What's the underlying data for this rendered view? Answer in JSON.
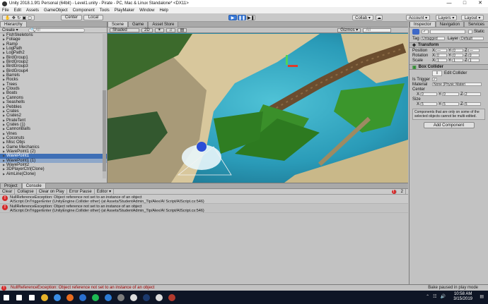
{
  "window": {
    "title": "Unity 2018.1.9f1 Personal (64bit) - Level1.unity - Pirate - PC, Mac & Linux Standalone* <DX11>",
    "controls": [
      "—",
      "□",
      "✕"
    ]
  },
  "menu": [
    "File",
    "Edit",
    "Assets",
    "GameObject",
    "Component",
    "Tools",
    "PlayMaker",
    "Window",
    "Help"
  ],
  "toolbar": {
    "pivot": "Center",
    "space": "Local",
    "play": "▶",
    "pause": "❚❚",
    "step": "▶❚",
    "collab": "Collab ▾",
    "account": "Account ▾",
    "layers": "Layers ▾",
    "layout": "Layout ▾"
  },
  "hierarchy": {
    "tab": "Hierarchy",
    "create": "Create ▾",
    "search_placeholder": "All",
    "items": [
      {
        "label": "FishSkeletons",
        "state": ""
      },
      {
        "label": "Foliage",
        "state": ""
      },
      {
        "label": "Ramp",
        "state": ""
      },
      {
        "label": "LogPath",
        "state": ""
      },
      {
        "label": "LogPath2",
        "state": ""
      },
      {
        "label": "BirdGroup1",
        "state": ""
      },
      {
        "label": "BirdGroup2",
        "state": ""
      },
      {
        "label": "BirdGroup3",
        "state": ""
      },
      {
        "label": "BirdGroup4",
        "state": ""
      },
      {
        "label": "Barrels",
        "state": ""
      },
      {
        "label": "Rocks",
        "state": ""
      },
      {
        "label": "Trees",
        "state": ""
      },
      {
        "label": "Clouds",
        "state": ""
      },
      {
        "label": "Boats",
        "state": ""
      },
      {
        "label": "Cannons",
        "state": ""
      },
      {
        "label": "Seashells",
        "state": ""
      },
      {
        "label": "Pebbles",
        "state": ""
      },
      {
        "label": "Crates",
        "state": ""
      },
      {
        "label": "Crates2",
        "state": ""
      },
      {
        "label": "PirateTent",
        "state": ""
      },
      {
        "label": "Crates (1)",
        "state": ""
      },
      {
        "label": "CannonBalls",
        "state": ""
      },
      {
        "label": "Vines",
        "state": ""
      },
      {
        "label": "Coconuts",
        "state": ""
      },
      {
        "label": "Misc Objs",
        "state": ""
      },
      {
        "label": "Game Mechanics",
        "state": ""
      },
      {
        "label": "WavePoint1 (2)",
        "state": ""
      },
      {
        "label": "WavePoint1",
        "state": "sel"
      },
      {
        "label": "WavePoint1 (1)",
        "state": "sel2"
      },
      {
        "label": "WavePoint2",
        "state": ""
      },
      {
        "label": "3DPlayerCtrl(Clone)",
        "state": ""
      },
      {
        "label": "AimLine(Clone)",
        "state": ""
      }
    ]
  },
  "scene": {
    "tabs": [
      "Scene",
      "Game",
      "Asset Store"
    ],
    "shading": "Shaded",
    "mode_2d": "2D",
    "gizmos": "Gizmos ▾",
    "search_placeholder": "All"
  },
  "inspector": {
    "tabs": [
      "Inspector",
      "Navigation",
      "Services"
    ],
    "static_label": "Static",
    "tag_label": "Tag",
    "tag_value": "Untagged",
    "layer_label": "Layer",
    "layer_value": "Default",
    "transform": {
      "title": "Transform",
      "position": {
        "label": "Position",
        "x": "—",
        "y": "0",
        "z": "—"
      },
      "rotation": {
        "label": "Rotation",
        "x": "0",
        "y": "0",
        "z": "0"
      },
      "scale": {
        "label": "Scale",
        "x": "1",
        "y": "1",
        "z": "1"
      }
    },
    "box_collider": {
      "title": "Box Collider",
      "edit_collider": "Edit Collider",
      "is_trigger": "Is Trigger",
      "is_trigger_mark": "✓",
      "material_label": "Material",
      "material_value": "None (Physic Materi",
      "center_label": "Center",
      "center": {
        "x": "0",
        "y": "0",
        "z": "2"
      },
      "size_label": "Size",
      "size": {
        "x": "5",
        "y": "5",
        "z": "5"
      }
    },
    "note": "Components that are only on some of the selected objects cannot be multi-edited.",
    "add_component": "Add Component"
  },
  "console": {
    "tabs": [
      "Project",
      "Console"
    ],
    "buttons": [
      "Clear",
      "Collapse",
      "Clear on Play",
      "Error Pause",
      "Editor ▾"
    ],
    "error_count": "2",
    "entries": [
      {
        "line1": "NullReferenceException: Object reference not set to an instance of an object",
        "line2": "AIScript.OnTriggerEnter (UnityEngine.Collider other) (at Assets/StudentAdmin_Tip/Alex/AI Script/AIScript.cs:546)"
      },
      {
        "line1": "NullReferenceException: Object reference not set to an instance of an object",
        "line2": "AIScript.OnTriggerEnter (UnityEngine.Collider other) (at Assets/StudentAdmin_Tip/Alex/AI Script/AIScript.cs:546)"
      }
    ]
  },
  "status": {
    "message": "NullReferenceException: Object reference not set to an instance of an object",
    "bake": "Bake paused in play mode"
  },
  "taskbar": {
    "time": "10:58 AM",
    "date": "3/15/2019",
    "icons": [
      "windows-start",
      "search",
      "task-view",
      "explorer",
      "chrome",
      "firefox",
      "media",
      "spotify",
      "edge",
      "store",
      "unity",
      "photoshop",
      "unity-hub",
      "app"
    ],
    "app_colors": [
      "#ffffff",
      "#ffffff",
      "#ffffff",
      "#e8b32a",
      "#3a8ee6",
      "#e86c1f",
      "#2a6fcf",
      "#1db954",
      "#2c7cd6",
      "#7d7d7d",
      "#dddddd",
      "#1c3a6e",
      "#dddddd",
      "#b23a2d"
    ]
  }
}
